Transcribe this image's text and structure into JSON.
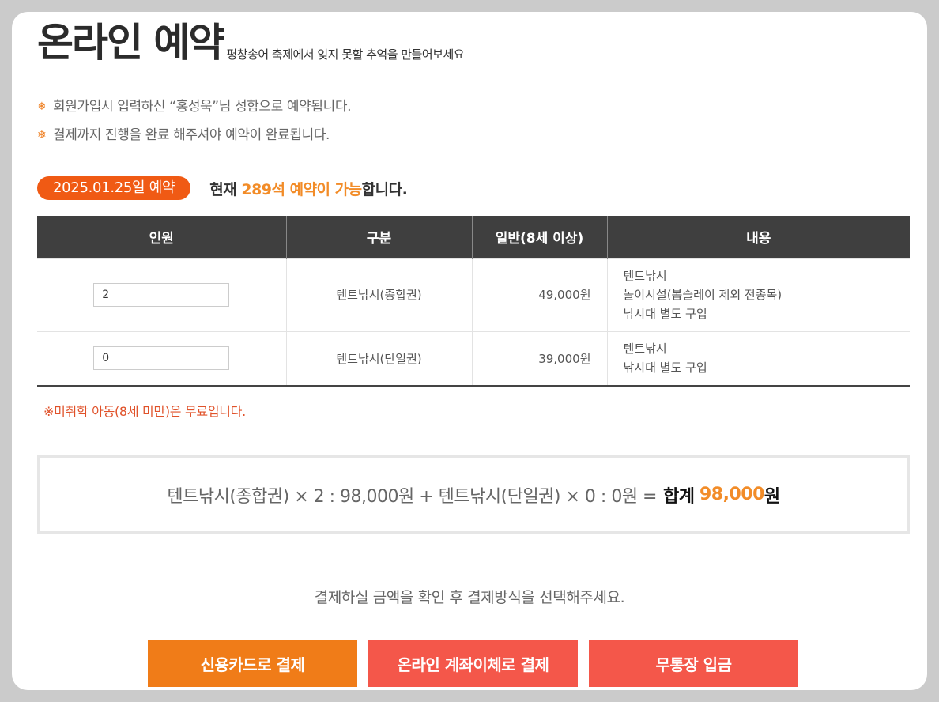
{
  "title": {
    "main": "온라인 예약",
    "sub": "평창송어 축제에서 잊지 못할 추억을 만들어보세요"
  },
  "notices": [
    "회원가입시 입력하신 “홍성욱”님 성함으로 예약됩니다.",
    "결제까지 진행을 완료 해주셔야 예약이 완료됩니다."
  ],
  "availability": {
    "date_badge": "2025.01.25일 예약",
    "prefix": "현재 ",
    "highlight": "289석 예약이 가능",
    "suffix": "합니다."
  },
  "table": {
    "headers": [
      "인원",
      "구분",
      "일반(8세 이상)",
      "내용"
    ],
    "rows": [
      {
        "qty": "2",
        "category": "텐트낚시(종합권)",
        "price": "49,000원",
        "desc": [
          "텐트낚시",
          "놀이시설(봅슬레이 제외 전종목)",
          "낚시대 별도 구입"
        ]
      },
      {
        "qty": "0",
        "category": "텐트낚시(단일권)",
        "price": "39,000원",
        "desc": [
          "텐트낚시",
          "낚시대 별도 구입"
        ]
      }
    ]
  },
  "free_note": "※미취학 아동(8세 미만)은 무료입니다.",
  "summary": {
    "formula": "텐트낚시(종합권) × 2 : 98,000원 + 텐트낚시(단일권) × 0 : 0원 =",
    "total_label": "합계",
    "total_amount": "98,000",
    "won": "원"
  },
  "pay_guide": "결제하실 금액을 확인 후 결제방식을 선택해주세요.",
  "buttons": {
    "card": "신용카드로 결제",
    "transfer": "온라인 계좌이체로 결제",
    "deposit": "무통장 입금"
  },
  "colors": {
    "accent_orange": "#f07c18",
    "accent_red": "#f4574a",
    "badge": "#f05a14",
    "highlight": "#f28c28"
  }
}
